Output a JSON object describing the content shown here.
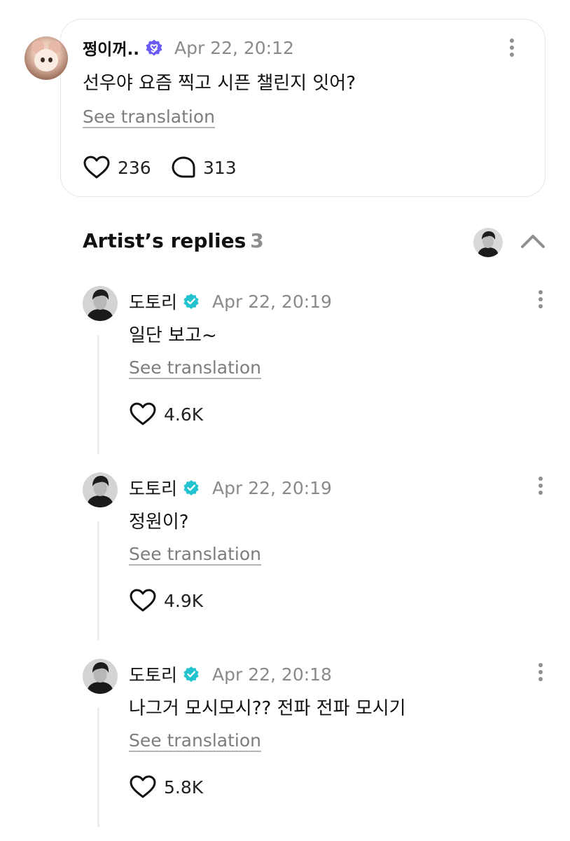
{
  "post": {
    "author": "쩡이꺼..",
    "time": "Apr 22, 20:12",
    "text": "선우야 요즘 찍고 시픈 챌린지 잇어?",
    "see_translation": "See translation",
    "likes": "236",
    "comments": "313",
    "badge_icon": "verified-fan-icon",
    "badge_color": "#6b5cf6"
  },
  "replies_section": {
    "title": "Artist’s replies",
    "count": "3"
  },
  "replies": [
    {
      "author": "도토리",
      "time": "Apr 22, 20:19",
      "text": "일단 보고~",
      "see_translation": "See translation",
      "likes": "4.6K"
    },
    {
      "author": "도토리",
      "time": "Apr 22, 20:19",
      "text": "정원이?",
      "see_translation": "See translation",
      "likes": "4.9K"
    },
    {
      "author": "도토리",
      "time": "Apr 22, 20:18",
      "text": "나그거 모시모시?? 전파 전파 모시기",
      "see_translation": "See translation",
      "likes": "5.8K"
    }
  ],
  "colors": {
    "verified_artist": "#22c3cf",
    "muted_text": "#8a8a8a",
    "card_border": "#e6e6e6"
  }
}
